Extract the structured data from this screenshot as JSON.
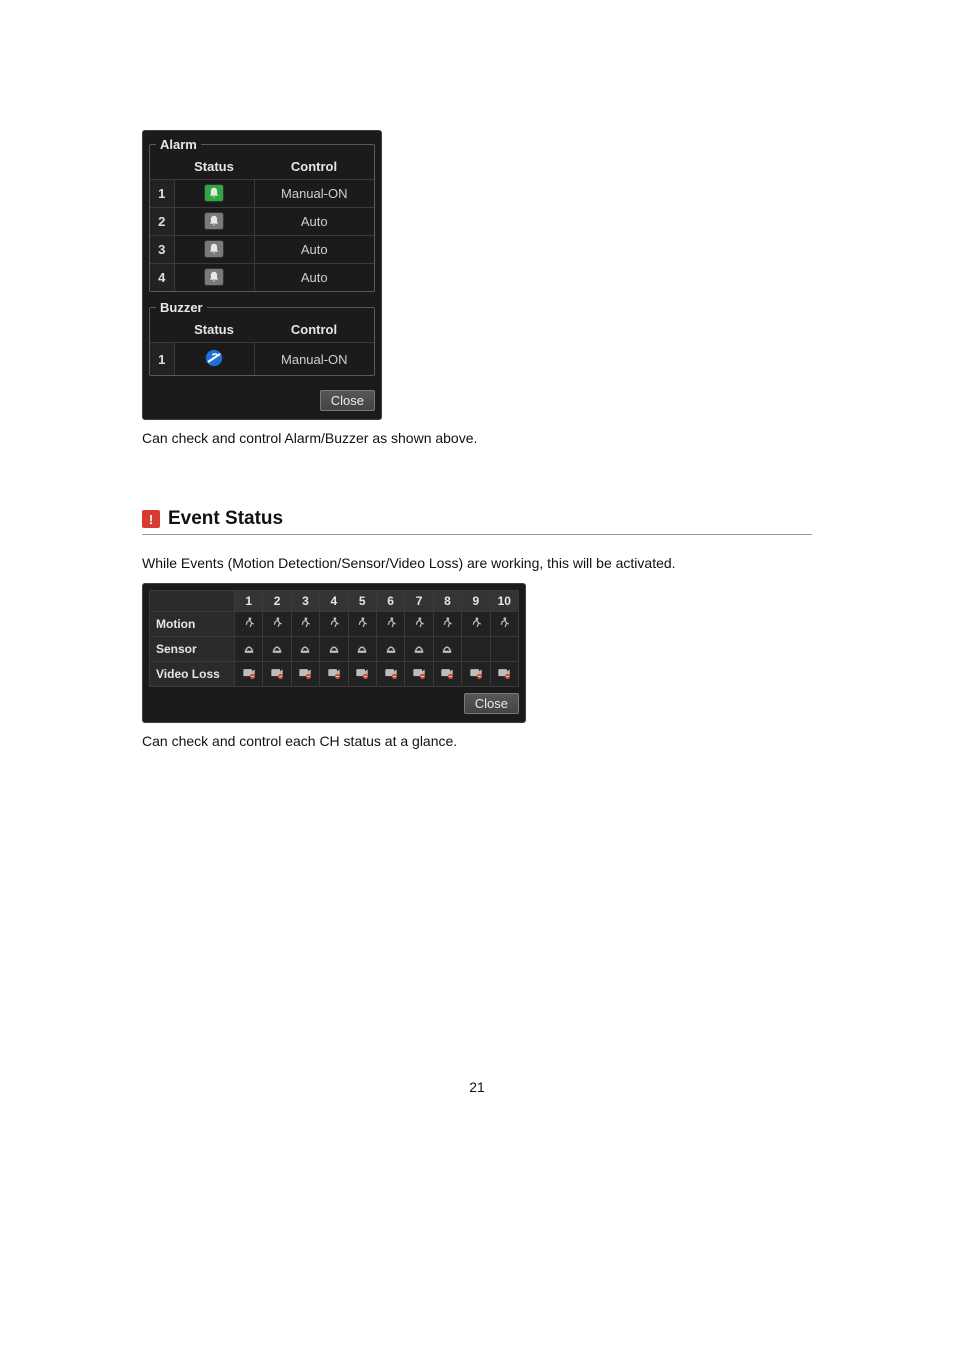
{
  "alarm_panel": {
    "alarm": {
      "legend": "Alarm",
      "headers": {
        "status": "Status",
        "control": "Control"
      },
      "rows": [
        {
          "idx": "1",
          "status": "on",
          "control": "Manual-ON"
        },
        {
          "idx": "2",
          "status": "off",
          "control": "Auto"
        },
        {
          "idx": "3",
          "status": "off",
          "control": "Auto"
        },
        {
          "idx": "4",
          "status": "off",
          "control": "Auto"
        }
      ]
    },
    "buzzer": {
      "legend": "Buzzer",
      "headers": {
        "status": "Status",
        "control": "Control"
      },
      "rows": [
        {
          "idx": "1",
          "status": "on",
          "control": "Manual-ON"
        }
      ]
    },
    "close": "Close",
    "caption": "Can check and control Alarm/Buzzer as shown above."
  },
  "section": {
    "icon_glyph": "!",
    "title": "Event Status"
  },
  "section_intro": "While Events (Motion Detection/Sensor/Video Loss) are working, this will be activated.",
  "events_panel": {
    "columns": [
      "1",
      "2",
      "3",
      "4",
      "5",
      "6",
      "7",
      "8",
      "9",
      "10"
    ],
    "rows": [
      {
        "label": "Motion",
        "cells": [
          "motion",
          "motion",
          "motion",
          "motion",
          "motion",
          "motion",
          "motion",
          "motion",
          "motion",
          "motion"
        ]
      },
      {
        "label": "Sensor",
        "cells": [
          "sensor",
          "sensor",
          "sensor",
          "sensor",
          "sensor",
          "sensor",
          "sensor",
          "sensor",
          "",
          ""
        ]
      },
      {
        "label": "Video Loss",
        "cells": [
          "vloss",
          "vloss",
          "vloss",
          "vloss",
          "vloss",
          "vloss",
          "vloss",
          "vloss",
          "vloss",
          "vloss"
        ]
      }
    ],
    "close": "Close",
    "caption": "Can check and control each CH status at a glance."
  },
  "page_number": "21"
}
